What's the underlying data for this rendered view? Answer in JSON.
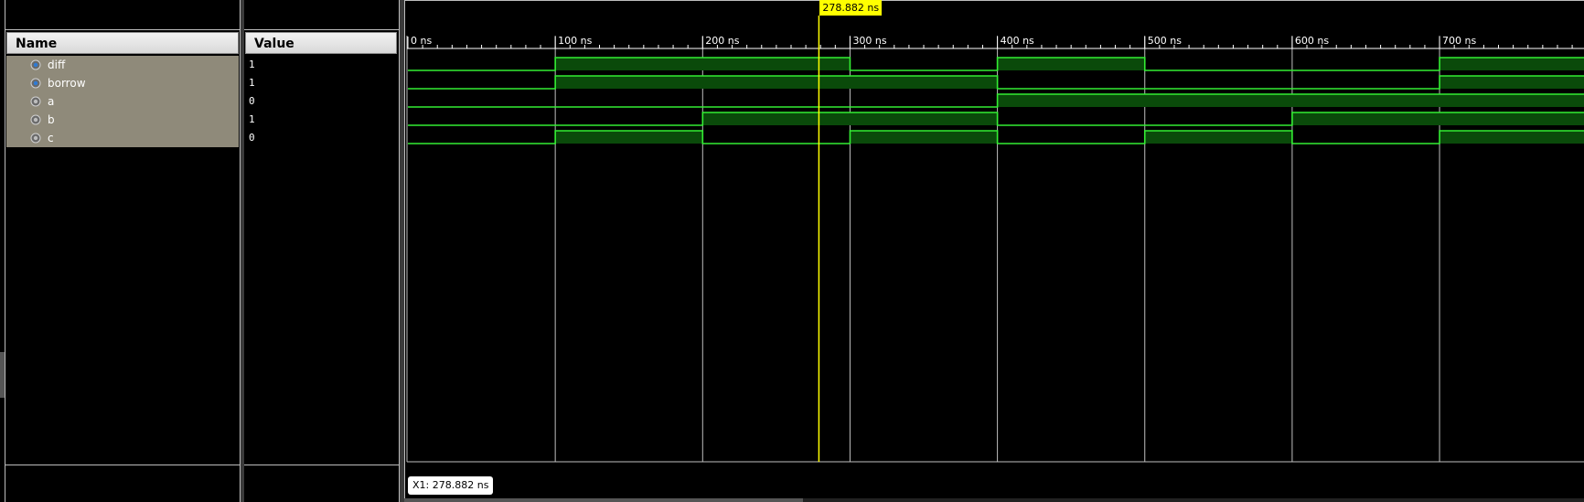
{
  "headers": {
    "name": "Name",
    "value": "Value"
  },
  "signals": [
    {
      "name": "diff",
      "value": "1",
      "icon": "output-port-icon",
      "transitions_ns": [
        0,
        100,
        300,
        400,
        500,
        700
      ],
      "levels": [
        0,
        1,
        0,
        1,
        0,
        1
      ]
    },
    {
      "name": "borrow",
      "value": "1",
      "icon": "output-port-icon",
      "transitions_ns": [
        0,
        100,
        400,
        700
      ],
      "levels": [
        0,
        1,
        0,
        1
      ]
    },
    {
      "name": "a",
      "value": "0",
      "icon": "input-port-icon",
      "transitions_ns": [
        0,
        400
      ],
      "levels": [
        0,
        1
      ]
    },
    {
      "name": "b",
      "value": "1",
      "icon": "input-port-icon",
      "transitions_ns": [
        0,
        200,
        400,
        600
      ],
      "levels": [
        0,
        1,
        0,
        1
      ]
    },
    {
      "name": "c",
      "value": "0",
      "icon": "input-port-icon",
      "transitions_ns": [
        0,
        100,
        200,
        300,
        400,
        500,
        600,
        700
      ],
      "levels": [
        0,
        1,
        0,
        1,
        0,
        1,
        0,
        1
      ]
    }
  ],
  "timeline": {
    "unit": "ns",
    "ticks": [
      "0 ns",
      "100 ns",
      "200 ns",
      "300 ns",
      "400 ns",
      "500 ns",
      "600 ns",
      "700 ns"
    ],
    "tick_values": [
      0,
      100,
      200,
      300,
      400,
      500,
      600,
      700
    ]
  },
  "cursor": {
    "time_ns": 278.882,
    "label": "278.882 ns",
    "readout": "X1: 278.882 ns"
  },
  "colors": {
    "wave": "#33ee33",
    "wave_fill": "#0a4a0a",
    "cursor": "#ffff00",
    "grid": "#bfbfbf"
  }
}
